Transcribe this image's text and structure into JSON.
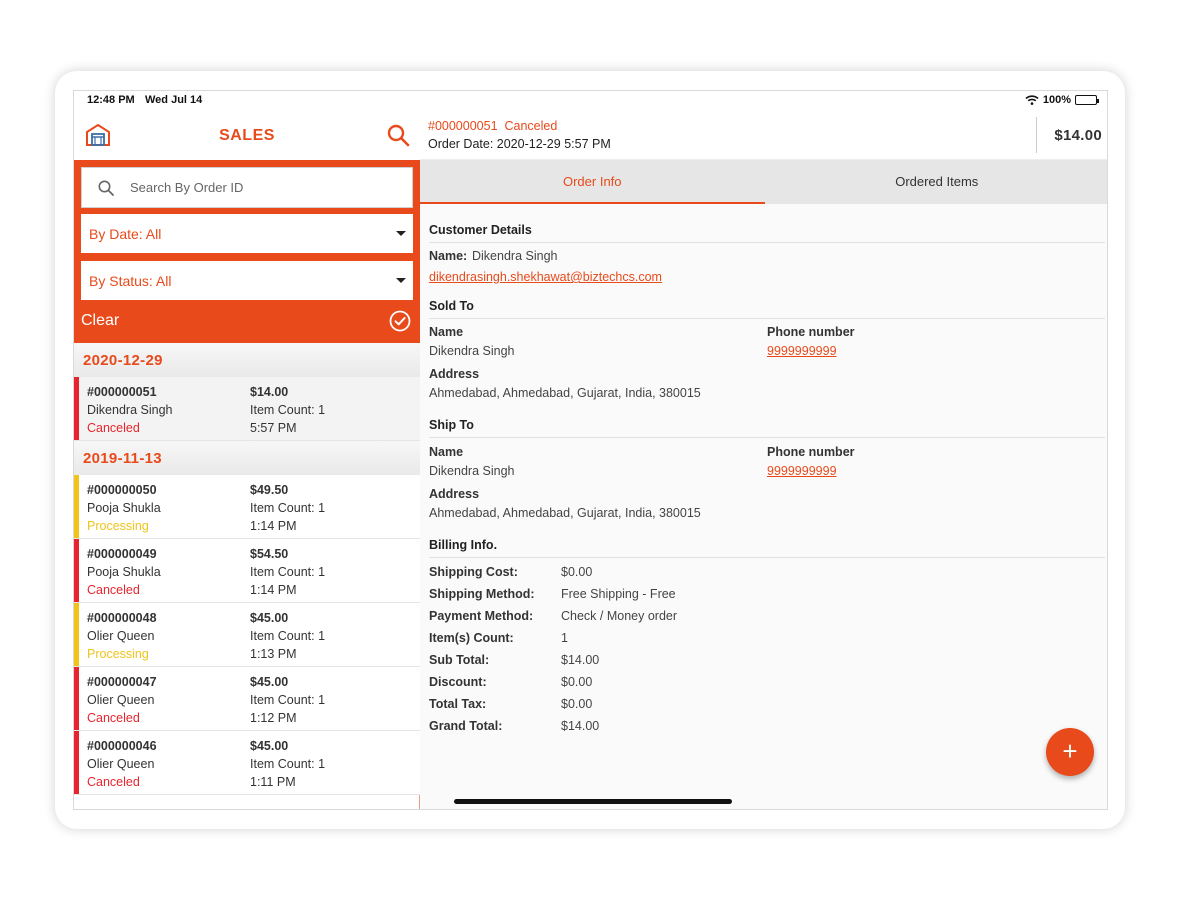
{
  "status_bar": {
    "time": "12:48 PM",
    "date": "Wed Jul 14",
    "battery": "100%"
  },
  "left_header": {
    "title": "SALES"
  },
  "filters": {
    "search_placeholder": "Search By Order ID",
    "by_date": "By Date: All",
    "by_status": "By Status: All",
    "clear_label": "Clear"
  },
  "colors": {
    "accent": "#e84a1b",
    "canceled": "#e8252e",
    "processing": "#f0c419"
  },
  "groups": [
    {
      "date": "2020-12-29",
      "orders": [
        {
          "id": "#000000051",
          "total": "$14.00",
          "customer": "Dikendra Singh",
          "item_count": "Item Count: 1",
          "status": "Canceled",
          "time": "5:57 PM"
        }
      ]
    },
    {
      "date": "2019-11-13",
      "orders": [
        {
          "id": "#000000050",
          "total": "$49.50",
          "customer": "Pooja Shukla",
          "item_count": "Item Count: 1",
          "status": "Processing",
          "time": "1:14 PM"
        },
        {
          "id": "#000000049",
          "total": "$54.50",
          "customer": "Pooja Shukla",
          "item_count": "Item Count: 1",
          "status": "Canceled",
          "time": "1:14 PM"
        },
        {
          "id": "#000000048",
          "total": "$45.00",
          "customer": "Olier Queen",
          "item_count": "Item Count: 1",
          "status": "Processing",
          "time": "1:13 PM"
        },
        {
          "id": "#000000047",
          "total": "$45.00",
          "customer": "Olier Queen",
          "item_count": "Item Count: 1",
          "status": "Canceled",
          "time": "1:12 PM"
        },
        {
          "id": "#000000046",
          "total": "$45.00",
          "customer": "Olier Queen",
          "item_count": "Item Count: 1",
          "status": "Canceled",
          "time": "1:11 PM"
        }
      ]
    }
  ],
  "detail": {
    "order_line": "#000000051  Canceled",
    "order_date": "Order Date: 2020-12-29 5:57 PM",
    "grand_total": "$14.00",
    "tabs": [
      "Order Info",
      "Ordered Items"
    ],
    "customer_details": {
      "title": "Customer Details",
      "name_label": "Name:",
      "name_value": "Dikendra Singh",
      "email": "dikendrasingh.shekhawat@biztechcs.com"
    },
    "sold_to": {
      "title": "Sold To",
      "name_label": "Name",
      "name": "Dikendra Singh",
      "phone_label": "Phone number",
      "phone": "9999999999",
      "address_label": "Address",
      "address": "Ahmedabad, Ahmedabad, Gujarat, India, 380015"
    },
    "ship_to": {
      "title": "Ship To",
      "name_label": "Name",
      "name": "Dikendra Singh",
      "phone_label": "Phone number",
      "phone": "9999999999",
      "address_label": "Address",
      "address": "Ahmedabad, Ahmedabad, Gujarat, India, 380015"
    },
    "billing": {
      "title": "Billing Info.",
      "rows": [
        {
          "label": "Shipping Cost:",
          "value": "$0.00"
        },
        {
          "label": "Shipping Method:",
          "value": "Free Shipping - Free"
        },
        {
          "label": "Payment Method:",
          "value": "Check / Money order"
        },
        {
          "label": "Item(s) Count:",
          "value": "1"
        },
        {
          "label": "Sub Total:",
          "value": "$14.00"
        },
        {
          "label": "Discount:",
          "value": "$0.00"
        },
        {
          "label": "Total Tax:",
          "value": "$0.00"
        },
        {
          "label": "Grand Total:",
          "value": "$14.00"
        }
      ]
    },
    "fab_label": "+"
  }
}
